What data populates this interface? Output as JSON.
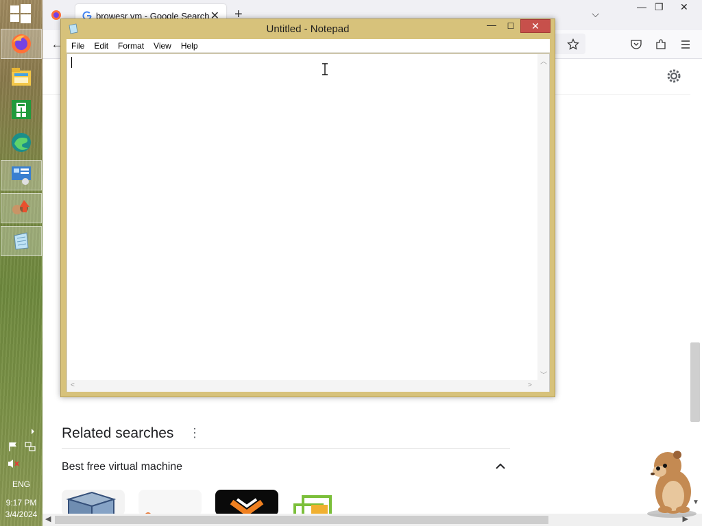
{
  "taskbar": {
    "apps": [
      {
        "name": "firefox",
        "icon": "firefox-icon",
        "active": true
      },
      {
        "name": "file-explorer",
        "icon": "file-explorer-icon",
        "active": false
      },
      {
        "name": "store",
        "icon": "store-icon",
        "active": false
      },
      {
        "name": "edge",
        "icon": "edge-icon",
        "active": false
      },
      {
        "name": "control-panel",
        "icon": "control-panel-icon",
        "active": true
      },
      {
        "name": "remote-app",
        "icon": "remote-app-icon",
        "active": true
      },
      {
        "name": "notepad",
        "icon": "notepad-icon",
        "active": true
      }
    ],
    "tray": {
      "language": "ENG",
      "time": "9:17 PM",
      "date": "3/4/2024"
    }
  },
  "browser": {
    "tab_title": "browesr vm - Google Search",
    "tab_close": "✕",
    "new_tab": "+",
    "tab_list": "⌵",
    "win_min": "—",
    "win_restore": "❐",
    "win_close": "✕",
    "related": {
      "title": "Related searches",
      "kebab": "⋮",
      "item": "Best free virtual machine"
    }
  },
  "notepad": {
    "title": "Untitled - Notepad",
    "min": "—",
    "max": "☐",
    "close": "✕",
    "menu": [
      "File",
      "Edit",
      "Format",
      "View",
      "Help"
    ],
    "content": ""
  },
  "colors": {
    "notepad_frame": "#d7c27b",
    "close_button": "#c7504b",
    "taskbar": "#7b8a45"
  }
}
